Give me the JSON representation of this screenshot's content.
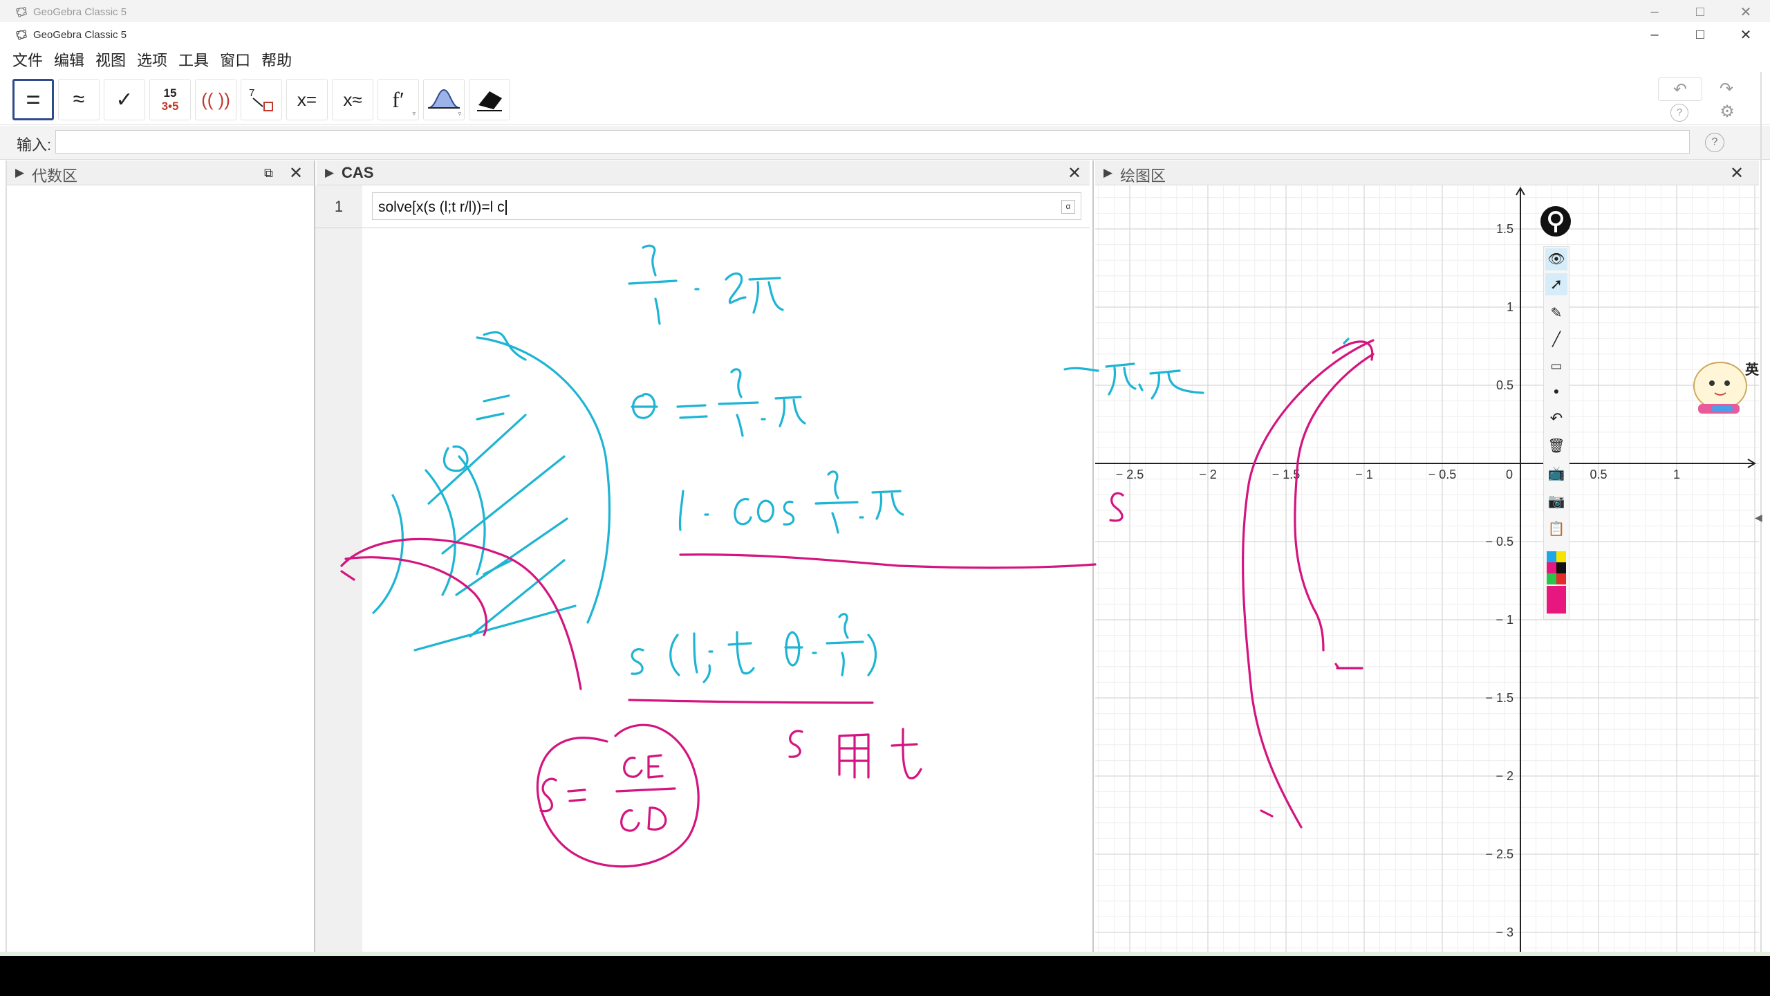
{
  "window": {
    "title_back": "GeoGebra Classic 5",
    "title_front": "GeoGebra Classic 5"
  },
  "menu": [
    "文件",
    "编辑",
    "视图",
    "选项",
    "工具",
    "窗口",
    "帮助"
  ],
  "toolbar": {
    "tools": [
      {
        "name": "evaluate-tool",
        "label": "="
      },
      {
        "name": "numeric-tool",
        "label": "≈"
      },
      {
        "name": "keep-input-tool",
        "label": "✓"
      },
      {
        "name": "factor-number-tool",
        "label_top": "15",
        "label_bottom": "3•5"
      },
      {
        "name": "expand-tool",
        "label": "(( ))"
      },
      {
        "name": "substitute-tool",
        "label": "7"
      },
      {
        "name": "solve-tool",
        "label": "x="
      },
      {
        "name": "solve-numerically-tool",
        "label": "x≈"
      },
      {
        "name": "derivative-tool",
        "label": "f′"
      },
      {
        "name": "probability-tool",
        "label": ""
      },
      {
        "name": "delete-tool",
        "label": ""
      }
    ]
  },
  "input": {
    "label": "输入:",
    "value": ""
  },
  "panels": {
    "algebra": {
      "title": "代数区"
    },
    "cas": {
      "title": "CAS"
    },
    "graphics": {
      "title": "绘图区"
    }
  },
  "cas": {
    "rows": [
      {
        "number": "1",
        "input": "solve[x(s (l;t r/l))=l c"
      }
    ],
    "alpha_button": "α"
  },
  "graphics": {
    "x_ticks": [
      "-2.5",
      "-2",
      "-1.5",
      "-1",
      "-0.5",
      "0",
      "0.5",
      "1"
    ],
    "y_ticks": [
      "1.5",
      "1",
      "0.5",
      "-0.5",
      "-1",
      "-1.5",
      "-2",
      "-2.5",
      "-3"
    ]
  },
  "colors": {
    "ink_cyan": "#1eb4d4",
    "ink_magenta": "#d4147f",
    "toolbar_selected": "#2f4b8c",
    "axis": "#222222",
    "grid_major": "#d6d6d6",
    "grid_minor": "#eeeeee"
  },
  "side_widget": {
    "label": "英"
  }
}
